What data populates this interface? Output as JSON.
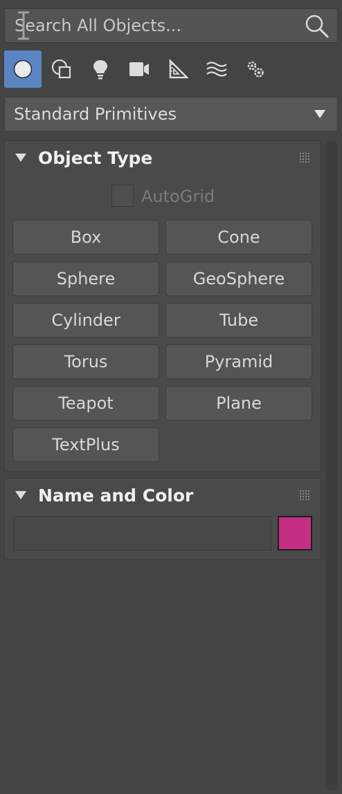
{
  "search": {
    "placeholder": "Search All Objects..."
  },
  "tabs": [
    {
      "name": "geometry",
      "icon": "sphere-icon",
      "active": true
    },
    {
      "name": "shapes",
      "icon": "shapes-icon",
      "active": false
    },
    {
      "name": "lights",
      "icon": "light-bulb-icon",
      "active": false
    },
    {
      "name": "cameras",
      "icon": "camera-icon",
      "active": false
    },
    {
      "name": "helpers",
      "icon": "helper-ruler-icon",
      "active": false
    },
    {
      "name": "space-warps",
      "icon": "space-warp-icon",
      "active": false
    },
    {
      "name": "systems",
      "icon": "systems-gears-icon",
      "active": false
    }
  ],
  "category_dropdown": {
    "selected": "Standard Primitives"
  },
  "object_type": {
    "title": "Object Type",
    "autogrid_label": "AutoGrid",
    "autogrid_checked": false,
    "buttons": [
      "Box",
      "Cone",
      "Sphere",
      "GeoSphere",
      "Cylinder",
      "Tube",
      "Torus",
      "Pyramid",
      "Teapot",
      "Plane",
      "TextPlus"
    ]
  },
  "name_and_color": {
    "title": "Name and Color",
    "name_value": "",
    "swatch_color": "#c42f84"
  },
  "colors": {
    "panel_bg": "#444444",
    "accent": "#5b85c2"
  }
}
